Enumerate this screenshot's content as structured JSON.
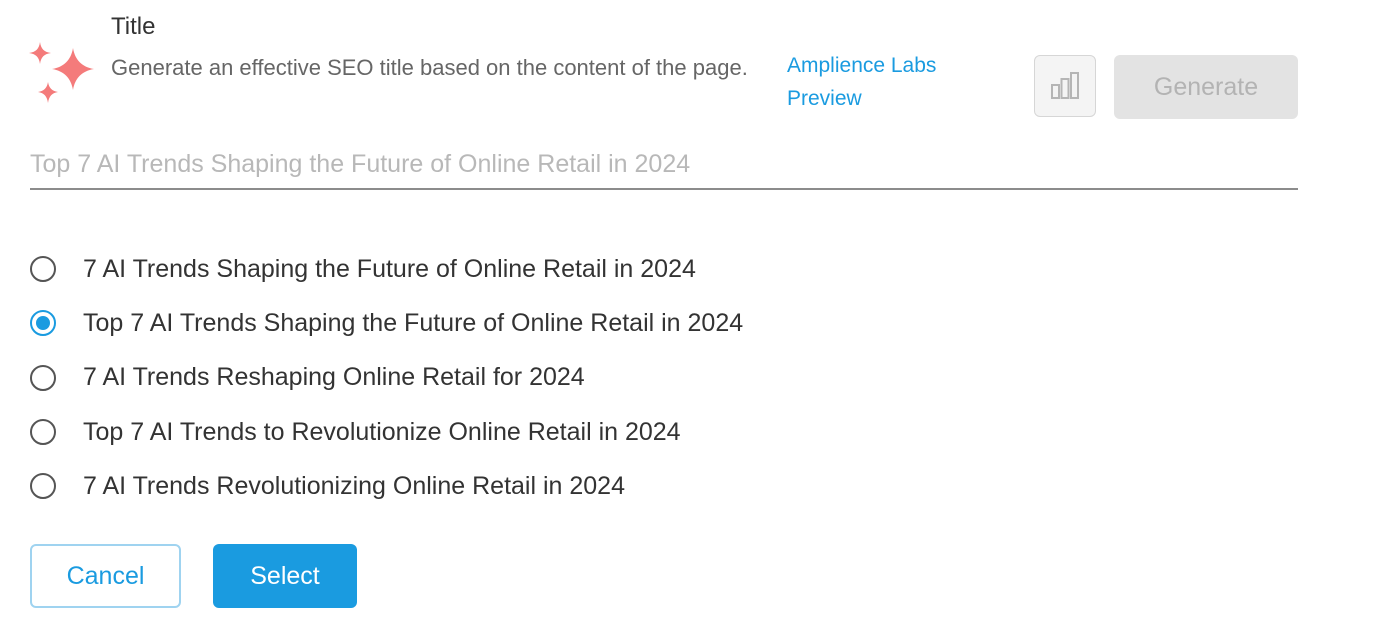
{
  "header": {
    "title": "Title",
    "description": "Generate an effective SEO title based on the content of the page.",
    "labs_link": "Amplience Labs Preview",
    "generate_label": "Generate",
    "icons": {
      "sparkle": "sparkle-icon",
      "stats": "bar-chart-icon"
    }
  },
  "title_input": {
    "value": "",
    "placeholder": "Top 7 AI Trends Shaping the Future of Online Retail in 2024"
  },
  "options": [
    {
      "label": "7 AI Trends Shaping the Future of Online Retail in 2024",
      "selected": false
    },
    {
      "label": "Top 7 AI Trends Shaping the Future of Online Retail in 2024",
      "selected": true
    },
    {
      "label": "7 AI Trends Reshaping Online Retail for 2024",
      "selected": false
    },
    {
      "label": "Top 7 AI Trends to Revolutionize Online Retail in 2024",
      "selected": false
    },
    {
      "label": "7 AI Trends Revolutionizing Online Retail in 2024",
      "selected": false
    }
  ],
  "footer": {
    "cancel_label": "Cancel",
    "select_label": "Select"
  },
  "colors": {
    "accent": "#1a9be0",
    "sparkle": "#f47b7b",
    "disabled_bg": "#e3e3e3",
    "disabled_text": "#b3b3b3"
  }
}
